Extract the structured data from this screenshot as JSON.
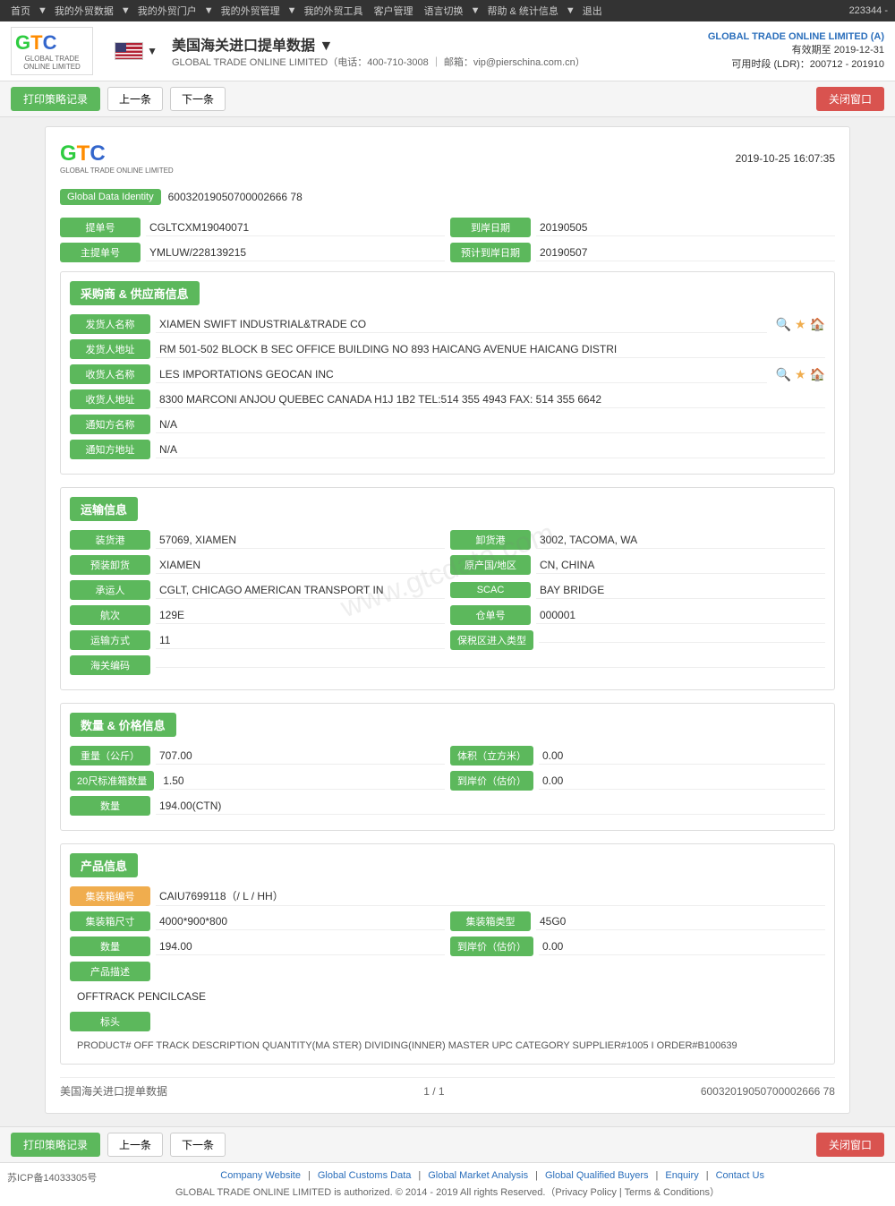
{
  "topbar": {
    "user_count": "223344 -",
    "nav_items": [
      "首页",
      "我的外贸数据",
      "我的外贸门户",
      "我的外贸管理",
      "我的外贸工具",
      "客户管理",
      "语言切换",
      "帮助 & 统计信息",
      "退出"
    ]
  },
  "header": {
    "logo_g": "G",
    "logo_t": "T",
    "logo_c": "C",
    "logo_sub": "GLOBAL TRADE ONLINE LIMITED",
    "title": "美国海关进口提单数据",
    "subtitle": "GLOBAL TRADE ONLINE LIMITED（电话：400-710-3008 ｜ 邮箱：vip@pierschina.com.cn）",
    "company": "GLOBAL TRADE ONLINE LIMITED (A)",
    "valid_until": "有效期至 2019-12-31",
    "available": "可用时段 (LDR)：200712 - 201910"
  },
  "toolbar": {
    "print_label": "打印策略记录",
    "prev_label": "上一条",
    "next_label": "下一条",
    "close_label": "关闭窗口"
  },
  "record": {
    "datetime": "2019-10-25 16:07:35",
    "global_data_identity_label": "Global Data Identity",
    "global_data_identity_value": "60032019050700002666 78",
    "fields": {
      "bill_no_label": "提单号",
      "bill_no_value": "CGLTCXM19040071",
      "arrival_date_label": "到岸日期",
      "arrival_date_value": "20190505",
      "master_bill_label": "主提单号",
      "master_bill_value": "YMLUW/228139215",
      "planned_date_label": "预计到岸日期",
      "planned_date_value": "20190507"
    }
  },
  "buyer_supplier": {
    "section_label": "采购商 & 供应商信息",
    "sender_name_label": "发货人名称",
    "sender_name_value": "XIAMEN SWIFT INDUSTRIAL&TRADE CO",
    "sender_address_label": "发货人地址",
    "sender_address_value": "RM 501-502 BLOCK B SEC OFFICE BUILDING NO 893 HAICANG AVENUE HAICANG DISTRI",
    "receiver_name_label": "收货人名称",
    "receiver_name_value": "LES IMPORTATIONS GEOCAN INC",
    "receiver_address_label": "收货人地址",
    "receiver_address_value": "8300 MARCONI ANJOU QUEBEC CANADA H1J 1B2 TEL:514 355 4943 FAX: 514 355 6642",
    "notify_name_label": "通知方名称",
    "notify_name_value": "N/A",
    "notify_address_label": "通知方地址",
    "notify_address_value": "N/A"
  },
  "transport": {
    "section_label": "运输信息",
    "loading_port_label": "装货港",
    "loading_port_value": "57069, XIAMEN",
    "unloading_port_label": "卸货港",
    "unloading_port_value": "3002, TACOMA, WA",
    "pre_unloading_label": "预装卸货",
    "pre_unloading_value": "XIAMEN",
    "destination_label": "原产国/地区",
    "destination_value": "CN, CHINA",
    "carrier_label": "承运人",
    "carrier_value": "CGLT, CHICAGO AMERICAN TRANSPORT IN",
    "carrier2_label": "SCAC",
    "carrier2_value": "BAY BRIDGE",
    "voyage_label": "航次",
    "voyage_value": "129E",
    "warehouse_label": "仓单号",
    "warehouse_value": "000001",
    "transport_mode_label": "运输方式",
    "transport_mode_value": "11",
    "bonded_label": "保税区进入类型",
    "bonded_value": "",
    "customs_code_label": "海关编码",
    "customs_code_value": ""
  },
  "quantity_price": {
    "section_label": "数量 & 价格信息",
    "weight_label": "重量（公斤）",
    "weight_value": "707.00",
    "volume_label": "体积（立方米）",
    "volume_value": "0.00",
    "container20_label": "20尺标准箱数量",
    "container20_value": "1.50",
    "unit_price_label": "到岸价（估价）",
    "unit_price_value": "0.00",
    "quantity_label": "数量",
    "quantity_value": "194.00(CTN)"
  },
  "product": {
    "section_label": "产品信息",
    "container_no_label": "集装箱编号",
    "container_no_value": "CAIU7699118（/ L / HH）",
    "container_size_label": "集装箱尺寸",
    "container_size_value": "4000*900*800",
    "container_type_label": "集装箱类型",
    "container_type_value": "45G0",
    "quantity_label": "数量",
    "quantity_value": "194.00",
    "unit_price_label": "到岸价（估价）",
    "unit_price_value": "0.00",
    "desc_label": "产品描述",
    "desc_value": "OFFTRACK PENCILCASE",
    "marks_label": "标头",
    "marks_value": "PRODUCT# OFF TRACK DESCRIPTION QUANTITY(MA STER) DIVIDING(INNER) MASTER UPC CATEGORY SUPPLIER#1005 I ORDER#B100639"
  },
  "pagination": {
    "source": "美国海关进口提单数据",
    "page": "1 / 1",
    "record_id": "60032019050700002666 78"
  },
  "footer": {
    "icp": "苏ICP备14033305号",
    "links": [
      "Company Website",
      "Global Customs Data",
      "Global Market Analysis",
      "Global Qualified Buyers",
      "Enquiry",
      "Contact Us"
    ],
    "copyright": "GLOBAL TRADE ONLINE LIMITED is authorized. © 2014 - 2019 All rights Reserved.（Privacy Policy | Terms & Conditions）"
  },
  "watermark": "www.gtcdata.com"
}
